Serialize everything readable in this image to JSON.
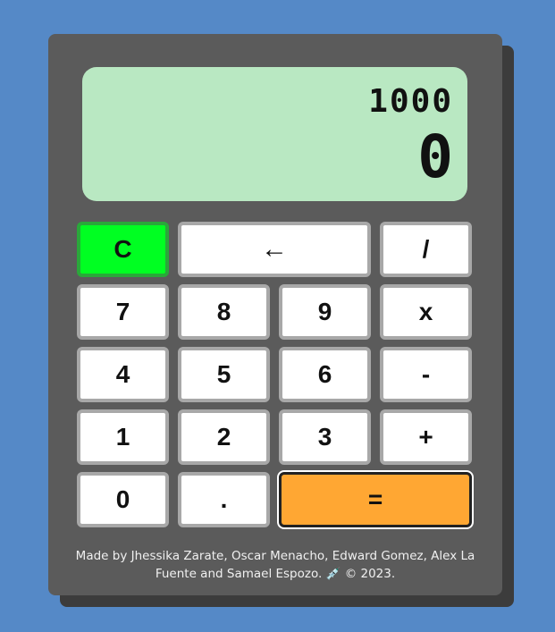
{
  "display": {
    "previous": "1000",
    "current": "0"
  },
  "keys": {
    "clear": "C",
    "backspace": "←",
    "divide": "/",
    "seven": "7",
    "eight": "8",
    "nine": "9",
    "multiply": "x",
    "four": "4",
    "five": "5",
    "six": "6",
    "subtract": "-",
    "one": "1",
    "two": "2",
    "three": "3",
    "add": "+",
    "zero": "0",
    "decimal": ".",
    "equals": "="
  },
  "footer": {
    "credits": "Made by Jhessika Zarate, Oscar Menacho, Edward Gomez, Alex La Fuente and Samael Espozo.",
    "emoji": "💉",
    "copyright": "© 2023."
  },
  "colors": {
    "background": "#5589c7",
    "body": "#5b5b5b",
    "display": "#b9e8c2",
    "clear_key": "#00ff22",
    "equals_key": "#ffa733"
  }
}
